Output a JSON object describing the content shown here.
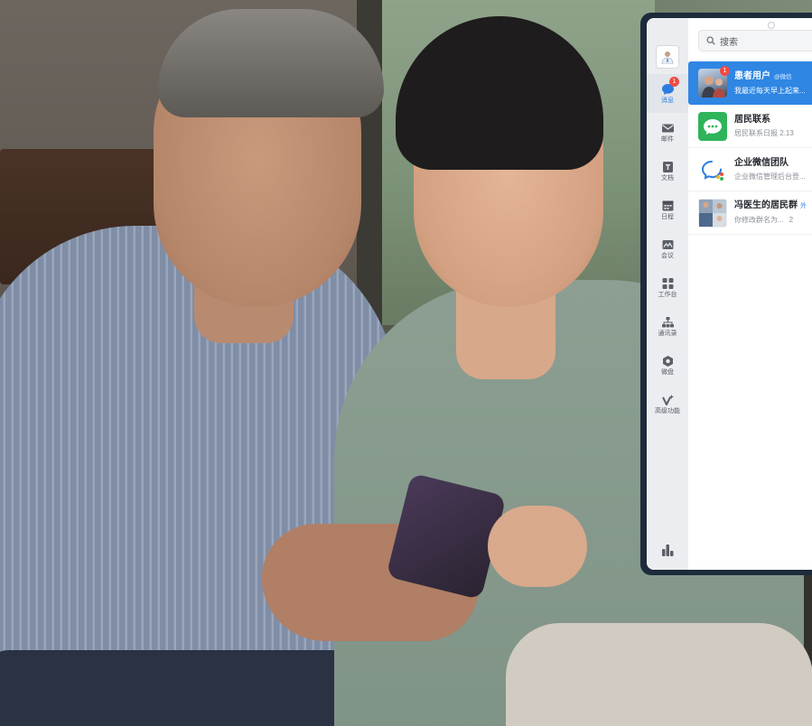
{
  "colors": {
    "accent": "#2f86e3",
    "badge": "#f04a43",
    "sidebar_bg": "#ecedf0",
    "device_frame": "#1d2b3b"
  },
  "sidebar": {
    "avatar_icon": "doctor-avatar-icon",
    "items": [
      {
        "label": "消息",
        "icon": "chat-bubble-icon",
        "badge": "1",
        "active": true
      },
      {
        "label": "邮件",
        "icon": "mail-icon"
      },
      {
        "label": "文档",
        "icon": "document-icon"
      },
      {
        "label": "日程",
        "icon": "calendar-icon"
      },
      {
        "label": "会议",
        "icon": "meeting-icon"
      },
      {
        "label": "工作台",
        "icon": "workbench-icon"
      },
      {
        "label": "通讯录",
        "icon": "contacts-icon"
      },
      {
        "label": "微盘",
        "icon": "drive-icon"
      },
      {
        "label": "高级功能",
        "icon": "advanced-icon"
      }
    ],
    "bottom_icon": "stats-icon"
  },
  "search": {
    "placeholder": "搜索"
  },
  "conversations": [
    {
      "title": "患者用户",
      "tag": "@微信",
      "preview": "我最近每天早上起来...",
      "badge": "1",
      "selected": true
    },
    {
      "title": "居民联系",
      "preview": "居民联系日报 2.13"
    },
    {
      "title": "企业微信团队",
      "preview": "企业微信管理后台登..."
    },
    {
      "title": "冯医生的居民群",
      "tag": "外",
      "preview": "你修改群名为...",
      "time": "2"
    }
  ]
}
